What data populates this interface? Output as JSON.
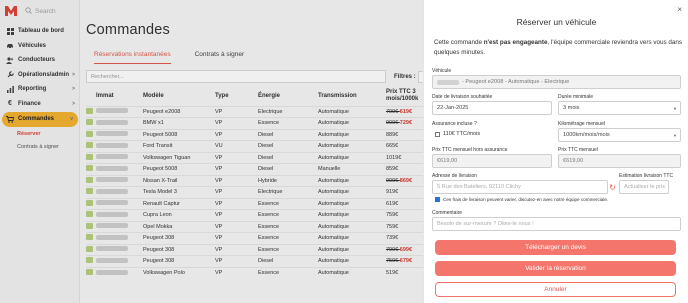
{
  "search": {
    "placeholder": "Search"
  },
  "sidebar": {
    "items": [
      {
        "label": "Tableau de bord",
        "icon": "dashboard-icon"
      },
      {
        "label": "Véhicules",
        "icon": "car-icon"
      },
      {
        "label": "Conducteurs",
        "icon": "users-icon"
      },
      {
        "label": "Opérations/admin",
        "icon": "wrench-icon",
        "chevron": ">"
      },
      {
        "label": "Reporting",
        "icon": "chart-icon",
        "chevron": ">"
      },
      {
        "label": "Finance",
        "icon": "euro-icon",
        "chevron": ">"
      },
      {
        "label": "Commandes",
        "icon": "cart-icon",
        "chevron": "v"
      }
    ],
    "sub_items": [
      "Réserver",
      "Contrats à signer"
    ]
  },
  "main": {
    "title": "Commandes",
    "tabs": [
      "Réservations instantanées",
      "Contrats à signer"
    ],
    "filter_placeholder": "Rechercher...",
    "filter_label": "Filtres :",
    "table": {
      "headers": [
        "Immat",
        "Modèle",
        "Type",
        "Énergie",
        "Transmission",
        "Prix TTC 3 mois/1000k"
      ],
      "rows": [
        {
          "model": "Peugeot e2008",
          "type": "VP",
          "energy": "Electrique",
          "trans": "Automatique",
          "price": "799€ 619€",
          "promo": true
        },
        {
          "model": "BMW x1",
          "type": "VP",
          "energy": "Essence",
          "trans": "Automatique",
          "price": "909€ 729€",
          "promo": true
        },
        {
          "model": "Peugeot 5008",
          "type": "VP",
          "energy": "Diesel",
          "trans": "Automatique",
          "price": "889€",
          "promo": false
        },
        {
          "model": "Ford Transit",
          "type": "VU",
          "energy": "Diesel",
          "trans": "Automatique",
          "price": "665€",
          "promo": false
        },
        {
          "model": "Volkswagen Tiguan",
          "type": "VP",
          "energy": "Diesel",
          "trans": "Automatique",
          "price": "1019€",
          "promo": false
        },
        {
          "model": "Peugeot 5008",
          "type": "VP",
          "energy": "Diesel",
          "trans": "Manuelle",
          "price": "859€",
          "promo": false
        },
        {
          "model": "Nissan X-Trail",
          "type": "VP",
          "energy": "Hybride",
          "trans": "Automatique",
          "price": "909€ 869€",
          "promo": true
        },
        {
          "model": "Tesla Model 3",
          "type": "VP",
          "energy": "Electrique",
          "trans": "Automatique",
          "price": "919€",
          "promo": false
        },
        {
          "model": "Renault Captur",
          "type": "VP",
          "energy": "Essence",
          "trans": "Automatique",
          "price": "619€",
          "promo": false
        },
        {
          "model": "Cupra Leon",
          "type": "VP",
          "energy": "Essence",
          "trans": "Automatique",
          "price": "759€",
          "promo": false
        },
        {
          "model": "Opel Mokka",
          "type": "VP",
          "energy": "Essence",
          "trans": "Automatique",
          "price": "759€",
          "promo": false
        },
        {
          "model": "Peugeot 308",
          "type": "VP",
          "energy": "Essence",
          "trans": "Automatique",
          "price": "739€",
          "promo": false
        },
        {
          "model": "Peugeot 308",
          "type": "VP",
          "energy": "Essence",
          "trans": "Automatique",
          "price": "799€ 699€",
          "promo": true
        },
        {
          "model": "Peugeot 308",
          "type": "VP",
          "energy": "Diesel",
          "trans": "Automatique",
          "price": "759€ 679€",
          "promo": true
        },
        {
          "model": "Volkswagen Polo",
          "type": "VP",
          "energy": "Essence",
          "trans": "Automatique",
          "price": "519€",
          "promo": false
        }
      ]
    }
  },
  "modal": {
    "title": "Réserver un véhicule",
    "intro_before": "Cette commande ",
    "intro_bold": "n'est pas engageante",
    "intro_after": ", l'équipe commerciale reviendra vers vous dans quelques minutes.",
    "vehicle_label": "Véhicule",
    "vehicle_value": "- Peugeot e2008 - Automatique - Electrique",
    "date_label": "Date de livraison souhaitée",
    "date_value": "22-Jan-2025",
    "duration_label": "Durée minimale",
    "duration_value": "3 mois",
    "insurance_label": "Assurance incluse ?",
    "insurance_option": "110€ TTC/mois",
    "km_label": "Kilométrage mensuel",
    "km_value": "1000km/mois/mois",
    "price_excl_label": "Prix TTC mensuel hors assurance",
    "price_excl_value": "€619,00",
    "price_label": "Prix TTC mensuel",
    "price_value": "€619,00",
    "address_label": "Adresse de livraison",
    "address_placeholder": "5 Rue des Bateliers, 92110 Clichy",
    "estimate_label": "Estimation livraison TTC",
    "estimate_placeholder": "Actualiser le prix",
    "fee_note": "Ces frais de livraison peuvent varier, discutez-en avec notre équipe commerciale.",
    "comment_label": "Commentaire",
    "comment_placeholder": "Besoin de sur-mesure ? Dites-le nous !",
    "download_button": "Télécharger un devis",
    "validate_button": "Valider la réservation",
    "cancel_button": "Annuler"
  },
  "colors": {
    "accent": "#f4756b",
    "sidebar_active": "#f4b331",
    "promo_price": "#d93a30"
  }
}
